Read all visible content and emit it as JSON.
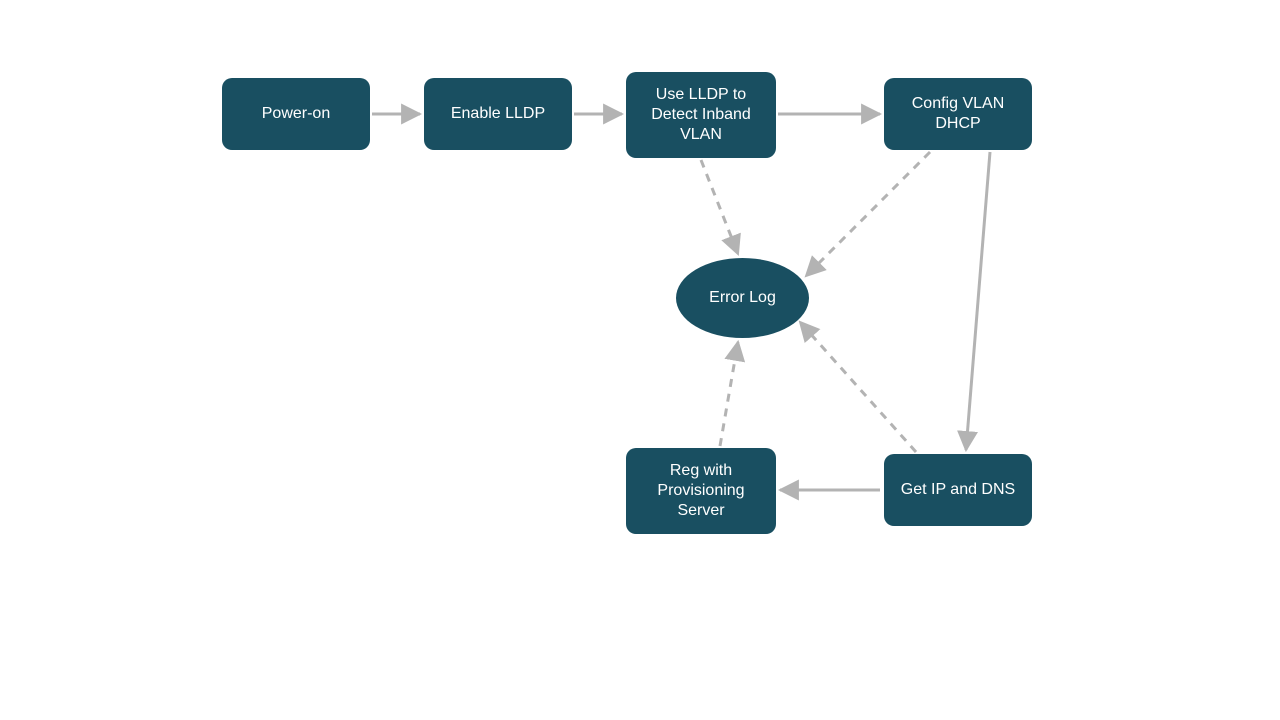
{
  "diagram": {
    "nodes": {
      "power_on": {
        "label": "Power-on"
      },
      "enable_lldp": {
        "label": "Enable LLDP"
      },
      "detect_vlan": {
        "label": "Use LLDP to Detect Inband VLAN"
      },
      "config_dhcp": {
        "label": "Config VLAN DHCP"
      },
      "error_log": {
        "label": "Error Log"
      },
      "get_ip_dns": {
        "label": "Get IP and DNS"
      },
      "reg_prov": {
        "label": "Reg with Provisioning Server"
      }
    },
    "edges": [
      {
        "from": "power_on",
        "to": "enable_lldp",
        "style": "solid"
      },
      {
        "from": "enable_lldp",
        "to": "detect_vlan",
        "style": "solid"
      },
      {
        "from": "detect_vlan",
        "to": "config_dhcp",
        "style": "solid"
      },
      {
        "from": "detect_vlan",
        "to": "error_log",
        "style": "dashed"
      },
      {
        "from": "config_dhcp",
        "to": "error_log",
        "style": "dashed"
      },
      {
        "from": "config_dhcp",
        "to": "get_ip_dns",
        "style": "solid"
      },
      {
        "from": "get_ip_dns",
        "to": "error_log",
        "style": "dashed"
      },
      {
        "from": "get_ip_dns",
        "to": "reg_prov",
        "style": "solid"
      },
      {
        "from": "reg_prov",
        "to": "error_log",
        "style": "dashed"
      }
    ],
    "colors": {
      "node_fill": "#194f61",
      "node_text": "#ffffff",
      "arrow": "#b3b3b3"
    }
  }
}
